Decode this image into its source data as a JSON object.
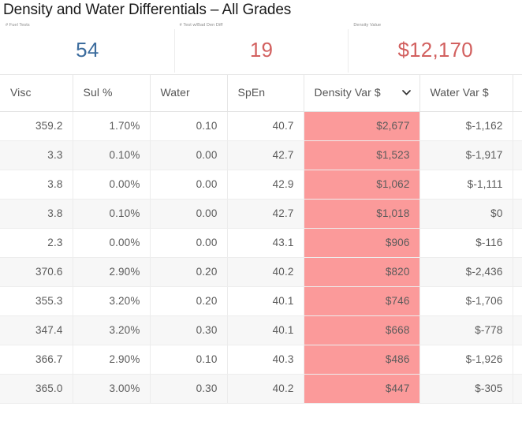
{
  "report": {
    "title": "Density and Water Differentials – All Grades"
  },
  "kpis": [
    {
      "label": "# Fuel Tests",
      "value": "54",
      "color": "#3d6d9e"
    },
    {
      "label": "# Test w/Bad Den Diff",
      "value": "19",
      "color": "#d2605f"
    },
    {
      "label": "Density Value",
      "value": "$12,170",
      "color": "#d2605f"
    }
  ],
  "table": {
    "sort": {
      "column": "Density Var $",
      "direction": "desc",
      "icon": "chevron-down-icon"
    },
    "highlight_color": "#fb9a9a",
    "columns": [
      {
        "key": "visc",
        "label": "Visc"
      },
      {
        "key": "sul",
        "label": "Sul %"
      },
      {
        "key": "water",
        "label": "Water"
      },
      {
        "key": "spen",
        "label": "SpEn"
      },
      {
        "key": "dvar",
        "label": "Density Var $",
        "sorted": true
      },
      {
        "key": "wvar",
        "label": "Water Var $"
      }
    ],
    "rows": [
      {
        "visc": "359.2",
        "sul": "1.70%",
        "water": "0.10",
        "spen": "40.7",
        "dvar": "$2,677",
        "wvar": "$-1,162"
      },
      {
        "visc": "3.3",
        "sul": "0.10%",
        "water": "0.00",
        "spen": "42.7",
        "dvar": "$1,523",
        "wvar": "$-1,917"
      },
      {
        "visc": "3.8",
        "sul": "0.00%",
        "water": "0.00",
        "spen": "42.9",
        "dvar": "$1,062",
        "wvar": "$-1,111"
      },
      {
        "visc": "3.8",
        "sul": "0.10%",
        "water": "0.00",
        "spen": "42.7",
        "dvar": "$1,018",
        "wvar": "$0"
      },
      {
        "visc": "2.3",
        "sul": "0.00%",
        "water": "0.00",
        "spen": "43.1",
        "dvar": "$906",
        "wvar": "$-116"
      },
      {
        "visc": "370.6",
        "sul": "2.90%",
        "water": "0.20",
        "spen": "40.2",
        "dvar": "$820",
        "wvar": "$-2,436"
      },
      {
        "visc": "355.3",
        "sul": "3.20%",
        "water": "0.20",
        "spen": "40.1",
        "dvar": "$746",
        "wvar": "$-1,706"
      },
      {
        "visc": "347.4",
        "sul": "3.20%",
        "water": "0.30",
        "spen": "40.1",
        "dvar": "$668",
        "wvar": "$-778"
      },
      {
        "visc": "366.7",
        "sul": "2.90%",
        "water": "0.10",
        "spen": "40.3",
        "dvar": "$486",
        "wvar": "$-1,926"
      },
      {
        "visc": "365.0",
        "sul": "3.00%",
        "water": "0.30",
        "spen": "40.2",
        "dvar": "$447",
        "wvar": "$-305"
      }
    ]
  }
}
